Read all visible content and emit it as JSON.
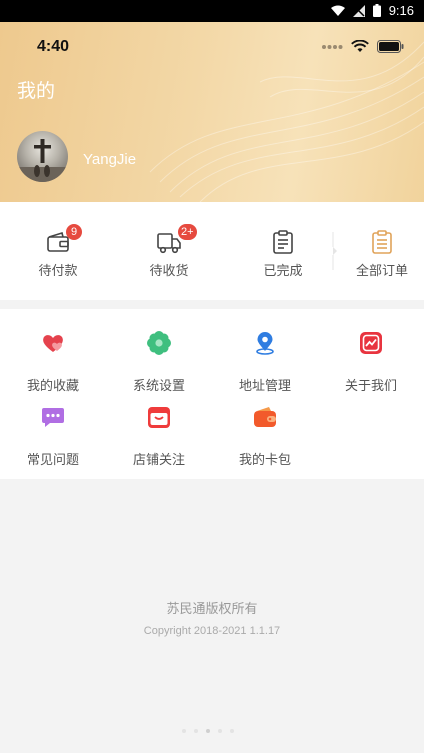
{
  "system_bar": {
    "time": "9:16"
  },
  "header": {
    "ios_time": "4:40",
    "title": "我的",
    "username": "YangJie"
  },
  "orders": [
    {
      "label": "待付款",
      "badge": "9",
      "icon": "wallet-icon"
    },
    {
      "label": "待收货",
      "badge": "2+",
      "icon": "truck-icon"
    },
    {
      "label": "已完成",
      "badge": "",
      "icon": "clipboard-icon"
    },
    {
      "label": "全部订单",
      "badge": "",
      "icon": "orders-list-icon"
    }
  ],
  "services": [
    {
      "label": "我的收藏",
      "icon": "favorites-heart-icon"
    },
    {
      "label": "系统设置",
      "icon": "settings-flower-icon"
    },
    {
      "label": "地址管理",
      "icon": "location-pin-icon"
    },
    {
      "label": "关于我们",
      "icon": "about-us-icon"
    },
    {
      "label": "常见问题",
      "icon": "faq-chat-icon"
    },
    {
      "label": "店铺关注",
      "icon": "shop-follow-icon"
    },
    {
      "label": "我的卡包",
      "icon": "card-wallet-icon"
    }
  ],
  "footer": {
    "name": "苏民通版权所有",
    "copyright": "Copyright 2018-2021 1.1.17"
  },
  "colors": {
    "header_gradient_start": "#eec98e",
    "header_gradient_end": "#f7e2b9",
    "badge": "#e64a3f",
    "order_all_icon": "#e0a35a"
  }
}
